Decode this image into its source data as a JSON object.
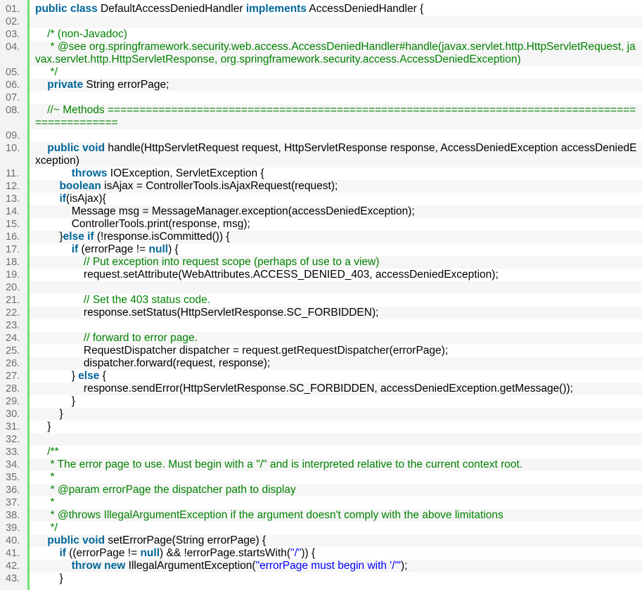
{
  "colors": {
    "keyword": "#006699",
    "comment": "#008200",
    "string": "#0000ff",
    "gutter_rule": "#6ce26c",
    "line_number": "#6e6e6e"
  },
  "lines": [
    {
      "n": "01.",
      "tokens": [
        {
          "t": "public class",
          "c": "kw"
        },
        {
          "t": " DefaultAccessDeniedHandler ",
          "c": "pl"
        },
        {
          "t": "implements",
          "c": "kw"
        },
        {
          "t": " AccessDeniedHandler {",
          "c": "pl"
        }
      ]
    },
    {
      "n": "02.",
      "tokens": []
    },
    {
      "n": "03.",
      "tokens": [
        {
          "t": "    /* (non-Javadoc)",
          "c": "cm"
        }
      ]
    },
    {
      "n": "04.",
      "tokens": [
        {
          "t": "     * @see org.springframework.security.web.access.AccessDeniedHandler#handle(javax.servlet.http.HttpServletRequest, javax.servlet.http.HttpServletResponse, org.springframework.security.access.AccessDeniedException)",
          "c": "cm"
        }
      ]
    },
    {
      "n": "05.",
      "tokens": [
        {
          "t": "     */",
          "c": "cm"
        }
      ]
    },
    {
      "n": "06.",
      "tokens": [
        {
          "t": "    ",
          "c": "pl"
        },
        {
          "t": "private",
          "c": "kw"
        },
        {
          "t": " String errorPage;",
          "c": "pl"
        }
      ]
    },
    {
      "n": "07.",
      "tokens": []
    },
    {
      "n": "08.",
      "tokens": [
        {
          "t": "    //~ Methods ================================================================================================",
          "c": "cm"
        }
      ]
    },
    {
      "n": "09.",
      "tokens": []
    },
    {
      "n": "10.",
      "tokens": [
        {
          "t": "    ",
          "c": "pl"
        },
        {
          "t": "public void",
          "c": "kw"
        },
        {
          "t": " handle(HttpServletRequest request, HttpServletResponse response, AccessDeniedException accessDeniedException)",
          "c": "pl"
        }
      ]
    },
    {
      "n": "11.",
      "tokens": [
        {
          "t": "            ",
          "c": "pl"
        },
        {
          "t": "throws",
          "c": "kw"
        },
        {
          "t": " IOException, ServletException {",
          "c": "pl"
        }
      ]
    },
    {
      "n": "12.",
      "tokens": [
        {
          "t": "        ",
          "c": "pl"
        },
        {
          "t": "boolean",
          "c": "kw"
        },
        {
          "t": " isAjax = ControllerTools.isAjaxRequest(request);",
          "c": "pl"
        }
      ]
    },
    {
      "n": "13.",
      "tokens": [
        {
          "t": "        ",
          "c": "pl"
        },
        {
          "t": "if",
          "c": "kw"
        },
        {
          "t": "(isAjax){",
          "c": "pl"
        }
      ]
    },
    {
      "n": "14.",
      "tokens": [
        {
          "t": "            Message msg = MessageManager.exception(accessDeniedException);",
          "c": "pl"
        }
      ]
    },
    {
      "n": "15.",
      "tokens": [
        {
          "t": "            ControllerTools.print(response, msg);",
          "c": "pl"
        }
      ]
    },
    {
      "n": "16.",
      "tokens": [
        {
          "t": "        }",
          "c": "pl"
        },
        {
          "t": "else if",
          "c": "kw"
        },
        {
          "t": " (!response.isCommitted()) {",
          "c": "pl"
        }
      ]
    },
    {
      "n": "17.",
      "tokens": [
        {
          "t": "            ",
          "c": "pl"
        },
        {
          "t": "if",
          "c": "kw"
        },
        {
          "t": " (errorPage != ",
          "c": "pl"
        },
        {
          "t": "null",
          "c": "kw"
        },
        {
          "t": ") {",
          "c": "pl"
        }
      ]
    },
    {
      "n": "18.",
      "tokens": [
        {
          "t": "                // Put exception into request scope (perhaps of use to a view)",
          "c": "cm"
        }
      ]
    },
    {
      "n": "19.",
      "tokens": [
        {
          "t": "                request.setAttribute(WebAttributes.ACCESS_DENIED_403, accessDeniedException);",
          "c": "pl"
        }
      ]
    },
    {
      "n": "20.",
      "tokens": []
    },
    {
      "n": "21.",
      "tokens": [
        {
          "t": "                // Set the 403 status code.",
          "c": "cm"
        }
      ]
    },
    {
      "n": "22.",
      "tokens": [
        {
          "t": "                response.setStatus(HttpServletResponse.SC_FORBIDDEN);",
          "c": "pl"
        }
      ]
    },
    {
      "n": "23.",
      "tokens": []
    },
    {
      "n": "24.",
      "tokens": [
        {
          "t": "                // forward to error page.",
          "c": "cm"
        }
      ]
    },
    {
      "n": "25.",
      "tokens": [
        {
          "t": "                RequestDispatcher dispatcher = request.getRequestDispatcher(errorPage);",
          "c": "pl"
        }
      ]
    },
    {
      "n": "26.",
      "tokens": [
        {
          "t": "                dispatcher.forward(request, response);",
          "c": "pl"
        }
      ]
    },
    {
      "n": "27.",
      "tokens": [
        {
          "t": "            } ",
          "c": "pl"
        },
        {
          "t": "else",
          "c": "kw"
        },
        {
          "t": " {",
          "c": "pl"
        }
      ]
    },
    {
      "n": "28.",
      "tokens": [
        {
          "t": "                response.sendError(HttpServletResponse.SC_FORBIDDEN, accessDeniedException.getMessage());",
          "c": "pl"
        }
      ]
    },
    {
      "n": "29.",
      "tokens": [
        {
          "t": "            }",
          "c": "pl"
        }
      ]
    },
    {
      "n": "30.",
      "tokens": [
        {
          "t": "        }",
          "c": "pl"
        }
      ]
    },
    {
      "n": "31.",
      "tokens": [
        {
          "t": "    }",
          "c": "pl"
        }
      ]
    },
    {
      "n": "32.",
      "tokens": []
    },
    {
      "n": "33.",
      "tokens": [
        {
          "t": "    /**",
          "c": "cm"
        }
      ]
    },
    {
      "n": "34.",
      "tokens": [
        {
          "t": "     * The error page to use. Must begin with a \"/\" and is interpreted relative to the current context root.",
          "c": "cm"
        }
      ]
    },
    {
      "n": "35.",
      "tokens": [
        {
          "t": "     *",
          "c": "cm"
        }
      ]
    },
    {
      "n": "36.",
      "tokens": [
        {
          "t": "     * @param errorPage the dispatcher path to display",
          "c": "cm"
        }
      ]
    },
    {
      "n": "37.",
      "tokens": [
        {
          "t": "     *",
          "c": "cm"
        }
      ]
    },
    {
      "n": "38.",
      "tokens": [
        {
          "t": "     * @throws IllegalArgumentException if the argument doesn't comply with the above limitations",
          "c": "cm"
        }
      ]
    },
    {
      "n": "39.",
      "tokens": [
        {
          "t": "     */",
          "c": "cm"
        }
      ]
    },
    {
      "n": "40.",
      "tokens": [
        {
          "t": "    ",
          "c": "pl"
        },
        {
          "t": "public void",
          "c": "kw"
        },
        {
          "t": " setErrorPage(String errorPage) {",
          "c": "pl"
        }
      ]
    },
    {
      "n": "41.",
      "tokens": [
        {
          "t": "        ",
          "c": "pl"
        },
        {
          "t": "if",
          "c": "kw"
        },
        {
          "t": " ((errorPage != ",
          "c": "pl"
        },
        {
          "t": "null",
          "c": "kw"
        },
        {
          "t": ") && !errorPage.startsWith(",
          "c": "pl"
        },
        {
          "t": "\"/\"",
          "c": "st"
        },
        {
          "t": ")) {",
          "c": "pl"
        }
      ]
    },
    {
      "n": "42.",
      "tokens": [
        {
          "t": "            ",
          "c": "pl"
        },
        {
          "t": "throw new",
          "c": "kw"
        },
        {
          "t": " IllegalArgumentException(",
          "c": "pl"
        },
        {
          "t": "\"errorPage must begin with '/'\"",
          "c": "st"
        },
        {
          "t": ");",
          "c": "pl"
        }
      ]
    },
    {
      "n": "43.",
      "tokens": [
        {
          "t": "        }",
          "c": "pl"
        }
      ]
    }
  ]
}
